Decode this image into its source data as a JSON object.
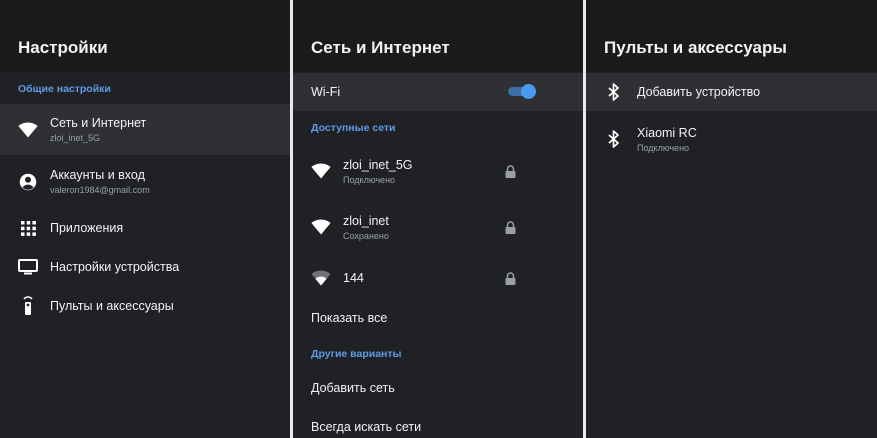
{
  "settings": {
    "title": "Настройки",
    "section": "Общие настройки",
    "items": [
      {
        "title": "Сеть и Интернет",
        "sub": "zloi_inet_5G"
      },
      {
        "title": "Аккаунты и вход",
        "sub": "valeron1984@gmail.com"
      },
      {
        "title": "Приложения"
      },
      {
        "title": "Настройки устройства"
      },
      {
        "title": "Пульты и аксессуары"
      }
    ]
  },
  "network": {
    "title": "Сеть и Интернет",
    "wifi_label": "Wi-Fi",
    "wifi_enabled": true,
    "available_label": "Доступные сети",
    "networks": [
      {
        "ssid": "zloi_inet_5G",
        "status": "Подключено"
      },
      {
        "ssid": "zloi_inet",
        "status": "Сохранено"
      },
      {
        "ssid": "144",
        "status": ""
      }
    ],
    "show_all": "Показать все",
    "other_label": "Другие варианты",
    "add_network": "Добавить сеть",
    "always_scan": "Всегда искать сети"
  },
  "remotes": {
    "title": "Пульты и аксессуары",
    "add_device": "Добавить устройство",
    "device": {
      "name": "Xiaomi RC",
      "status": "Подключено"
    }
  },
  "colors": {
    "accent": "#5e9be6",
    "background": "#202124",
    "header": "#1a1b1d",
    "selected": "#2f3034"
  }
}
